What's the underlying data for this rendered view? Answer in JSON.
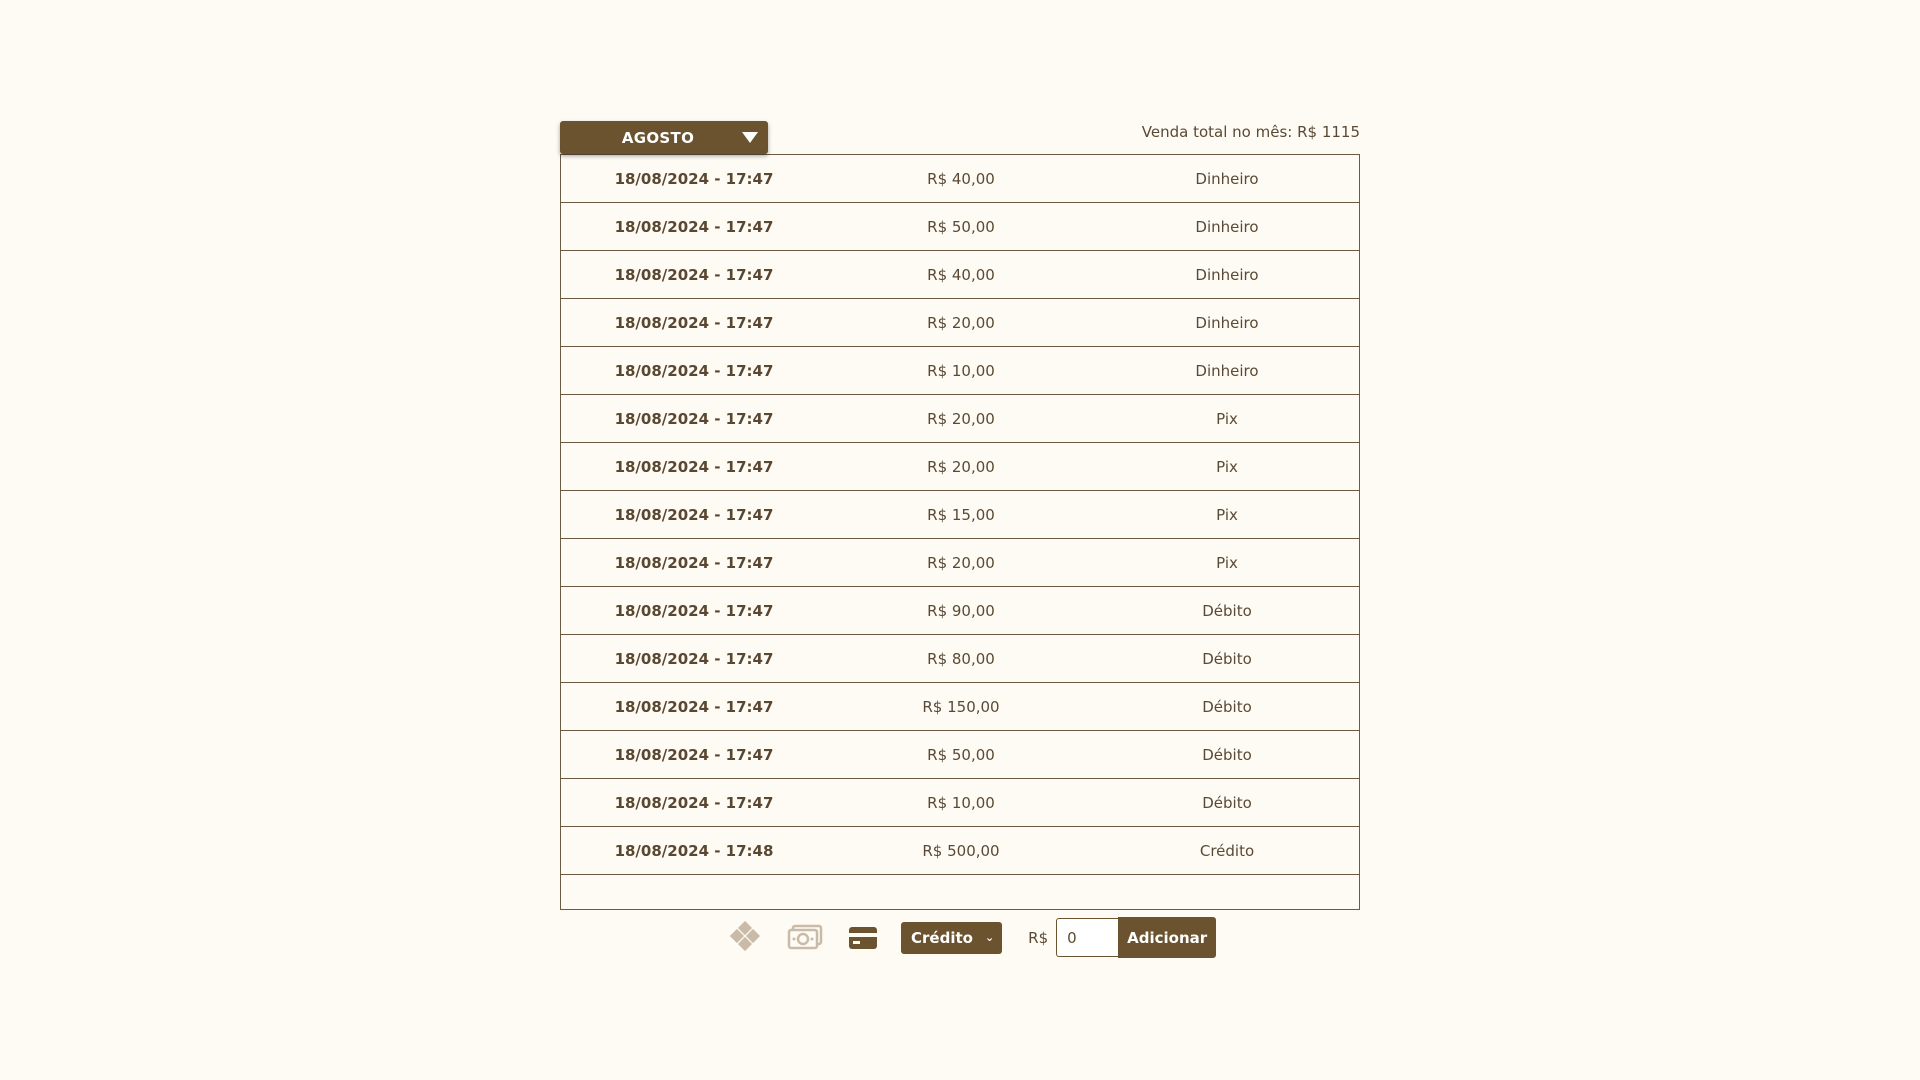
{
  "header": {
    "month_label": "AGOSTO",
    "total_label": "Venda total no mês: R$ 1115"
  },
  "sales": [
    {
      "date": "18/08/2024 - 17:47",
      "value": "R$ 40,00",
      "method": "Dinheiro"
    },
    {
      "date": "18/08/2024 - 17:47",
      "value": "R$ 50,00",
      "method": "Dinheiro"
    },
    {
      "date": "18/08/2024 - 17:47",
      "value": "R$ 40,00",
      "method": "Dinheiro"
    },
    {
      "date": "18/08/2024 - 17:47",
      "value": "R$ 20,00",
      "method": "Dinheiro"
    },
    {
      "date": "18/08/2024 - 17:47",
      "value": "R$ 10,00",
      "method": "Dinheiro"
    },
    {
      "date": "18/08/2024 - 17:47",
      "value": "R$ 20,00",
      "method": "Pix"
    },
    {
      "date": "18/08/2024 - 17:47",
      "value": "R$ 20,00",
      "method": "Pix"
    },
    {
      "date": "18/08/2024 - 17:47",
      "value": "R$ 15,00",
      "method": "Pix"
    },
    {
      "date": "18/08/2024 - 17:47",
      "value": "R$ 20,00",
      "method": "Pix"
    },
    {
      "date": "18/08/2024 - 17:47",
      "value": "R$ 90,00",
      "method": "Débito"
    },
    {
      "date": "18/08/2024 - 17:47",
      "value": "R$ 80,00",
      "method": "Débito"
    },
    {
      "date": "18/08/2024 - 17:47",
      "value": "R$ 150,00",
      "method": "Débito"
    },
    {
      "date": "18/08/2024 - 17:47",
      "value": "R$ 50,00",
      "method": "Débito"
    },
    {
      "date": "18/08/2024 - 17:47",
      "value": "R$ 10,00",
      "method": "Débito"
    },
    {
      "date": "18/08/2024 - 17:48",
      "value": "R$ 500,00",
      "method": "Crédito"
    }
  ],
  "controls": {
    "icons": [
      "pix-icon",
      "cash-icon",
      "card-icon"
    ],
    "method_selected": "Crédito",
    "currency_label": "R$",
    "amount_value": "0",
    "add_label": "Adicionar"
  },
  "colors": {
    "background": "#fefbf5",
    "accent": "#6b532f",
    "text": "#5a4a35",
    "icon_muted": "#c9bba8"
  }
}
